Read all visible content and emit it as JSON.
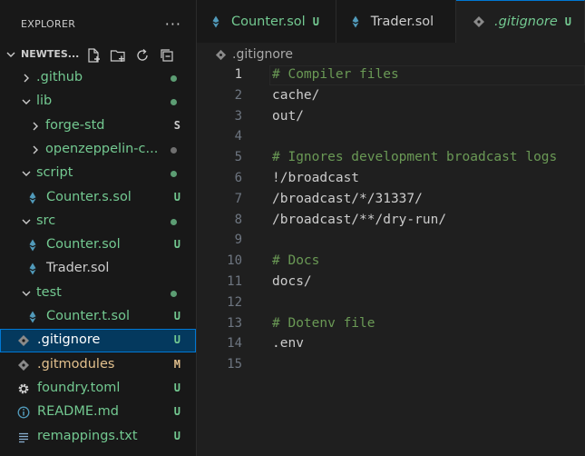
{
  "explorer": {
    "title": "EXPLORER",
    "more": "···",
    "root_name": "NEWTES...",
    "items": [
      {
        "id": "github",
        "name": ".github",
        "type": "folder",
        "open": false,
        "depth": 0,
        "dot": "#73c991",
        "color": "#73c991"
      },
      {
        "id": "lib",
        "name": "lib",
        "type": "folder",
        "open": true,
        "depth": 0,
        "dot": "#73c991",
        "color": "#73c991"
      },
      {
        "id": "forge-std",
        "name": "forge-std",
        "type": "folder",
        "open": false,
        "depth": 1,
        "badge": "S",
        "badgeColor": "#cccccc",
        "color": "#73c991"
      },
      {
        "id": "openzeppelin",
        "name": "openzeppelin-c...",
        "type": "folder",
        "open": false,
        "depth": 1,
        "dot": "#8c8c8c",
        "color": "#73c991"
      },
      {
        "id": "script",
        "name": "script",
        "type": "folder",
        "open": true,
        "depth": 0,
        "dot": "#73c991",
        "color": "#73c991"
      },
      {
        "id": "counter-s-sol",
        "name": "Counter.s.sol",
        "type": "sol",
        "depth": 1,
        "badge": "U",
        "badgeColor": "#73c991",
        "color": "#73c991"
      },
      {
        "id": "src",
        "name": "src",
        "type": "folder",
        "open": true,
        "depth": 0,
        "dot": "#73c991",
        "color": "#73c991"
      },
      {
        "id": "counter-sol",
        "name": "Counter.sol",
        "type": "sol",
        "depth": 1,
        "badge": "U",
        "badgeColor": "#73c991",
        "color": "#73c991"
      },
      {
        "id": "trader-sol",
        "name": "Trader.sol",
        "type": "sol",
        "depth": 1,
        "color": "#cccccc"
      },
      {
        "id": "test",
        "name": "test",
        "type": "folder",
        "open": true,
        "depth": 0,
        "dot": "#73c991",
        "color": "#73c991"
      },
      {
        "id": "counter-t-sol",
        "name": "Counter.t.sol",
        "type": "sol",
        "depth": 1,
        "badge": "U",
        "badgeColor": "#73c991",
        "color": "#73c991"
      },
      {
        "id": "gitignore",
        "name": ".gitignore",
        "type": "git",
        "depth": 0,
        "badge": "U",
        "badgeColor": "#73c991",
        "color": "#ffffff",
        "selected": true
      },
      {
        "id": "gitmodules",
        "name": ".gitmodules",
        "type": "git",
        "depth": 0,
        "badge": "M",
        "badgeColor": "#e2c08d",
        "color": "#e2c08d"
      },
      {
        "id": "foundry-toml",
        "name": "foundry.toml",
        "type": "gear",
        "depth": 0,
        "badge": "U",
        "badgeColor": "#73c991",
        "color": "#73c991"
      },
      {
        "id": "readme",
        "name": "README.md",
        "type": "info",
        "depth": 0,
        "badge": "U",
        "badgeColor": "#73c991",
        "color": "#73c991"
      },
      {
        "id": "remappings",
        "name": "remappings.txt",
        "type": "lines",
        "depth": 0,
        "badge": "U",
        "badgeColor": "#73c991",
        "color": "#73c991"
      }
    ]
  },
  "tabs": [
    {
      "id": "counter",
      "name": "Counter.sol",
      "icon": "sol",
      "badge": "U",
      "color": "#73c991",
      "active": false
    },
    {
      "id": "trader",
      "name": "Trader.sol",
      "icon": "sol",
      "badge": "",
      "color": "#cccccc",
      "active": false
    },
    {
      "id": "gitignore",
      "name": ".gitignore",
      "icon": "git",
      "badge": "U",
      "color": "#73c991",
      "active": true
    }
  ],
  "breadcrumb": {
    "file": ".gitignore"
  },
  "colors": {
    "accent": "#0078d4",
    "sol_icon": "#519aba",
    "git_icon": "#8a8a8a",
    "comment": "#6a9955"
  },
  "editor": {
    "current_line": 1,
    "lines": [
      {
        "n": "1",
        "text": "# Compiler files",
        "comment": true
      },
      {
        "n": "2",
        "text": "cache/",
        "comment": false
      },
      {
        "n": "3",
        "text": "out/",
        "comment": false
      },
      {
        "n": "4",
        "text": "",
        "comment": false
      },
      {
        "n": "5",
        "text": "# Ignores development broadcast logs",
        "comment": true
      },
      {
        "n": "6",
        "text": "!/broadcast",
        "comment": false
      },
      {
        "n": "7",
        "text": "/broadcast/*/31337/",
        "comment": false
      },
      {
        "n": "8",
        "text": "/broadcast/**/dry-run/",
        "comment": false
      },
      {
        "n": "9",
        "text": "",
        "comment": false
      },
      {
        "n": "10",
        "text": "# Docs",
        "comment": true
      },
      {
        "n": "11",
        "text": "docs/",
        "comment": false
      },
      {
        "n": "12",
        "text": "",
        "comment": false
      },
      {
        "n": "13",
        "text": "# Dotenv file",
        "comment": true
      },
      {
        "n": "14",
        "text": ".env",
        "comment": false
      },
      {
        "n": "15",
        "text": "",
        "comment": false
      }
    ]
  }
}
